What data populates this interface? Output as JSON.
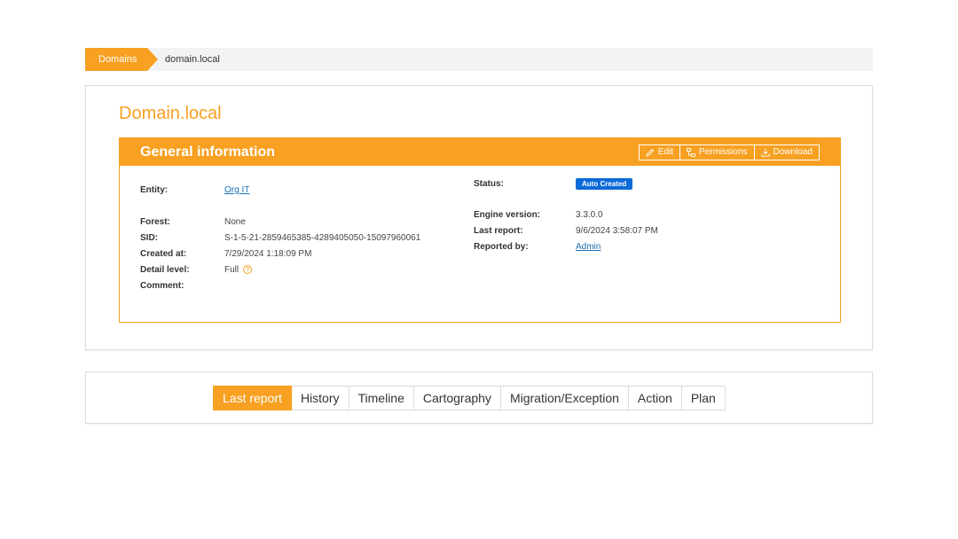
{
  "breadcrumb": {
    "root": "Domains",
    "current": "domain.local"
  },
  "domain": {
    "title": "Domain.local"
  },
  "panel": {
    "title": "General information",
    "actions": {
      "edit": "Edit",
      "permissions": "Permissions",
      "download": "Download"
    }
  },
  "info": {
    "entity": {
      "label": "Entity:",
      "value": "Org IT"
    },
    "forest": {
      "label": "Forest:",
      "value": "None"
    },
    "sid": {
      "label": "SID:",
      "value": "S-1-5-21-2859465385-4289405050-15097960061"
    },
    "created_at": {
      "label": "Created at:",
      "value": "7/29/2024 1:18:09 PM"
    },
    "detail_level": {
      "label": "Detail level:",
      "value": "Full",
      "help": "?"
    },
    "comment": {
      "label": "Comment:",
      "value": ""
    },
    "status": {
      "label": "Status:",
      "value": "Auto Created"
    },
    "engine_version": {
      "label": "Engine version:",
      "value": "3.3.0.0"
    },
    "last_report": {
      "label": "Last report:",
      "value": "9/6/2024 3:58:07 PM"
    },
    "reported_by": {
      "label": "Reported by:",
      "value": "Admin"
    }
  },
  "tabs": [
    {
      "label": "Last report",
      "active": true
    },
    {
      "label": "History"
    },
    {
      "label": "Timeline"
    },
    {
      "label": "Cartography"
    },
    {
      "label": "Migration/Exception"
    },
    {
      "label": "Action"
    },
    {
      "label": "Plan"
    }
  ],
  "colors": {
    "accent": "#f7a021",
    "badge": "#0d6ad9",
    "link": "#1a6fb5"
  }
}
